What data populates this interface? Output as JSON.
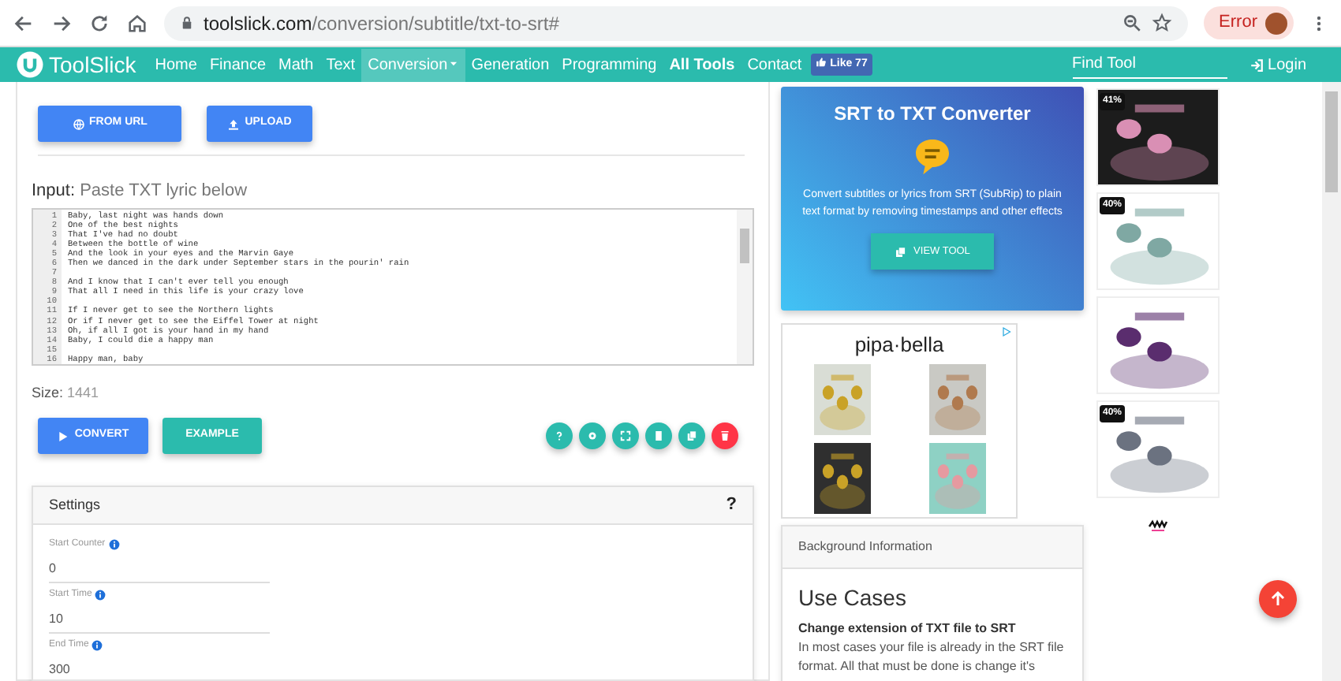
{
  "browser": {
    "url_host": "toolslick.com",
    "url_path": "/conversion/subtitle/txt-to-srt#",
    "profile_status": "Error"
  },
  "navbar": {
    "brand": "ToolSlick",
    "links": [
      {
        "label": "Home",
        "selected": false,
        "bold": false,
        "dropdown": false
      },
      {
        "label": "Finance",
        "selected": false,
        "bold": false,
        "dropdown": false
      },
      {
        "label": "Math",
        "selected": false,
        "bold": false,
        "dropdown": false
      },
      {
        "label": "Text",
        "selected": false,
        "bold": false,
        "dropdown": false
      },
      {
        "label": "Conversion",
        "selected": true,
        "bold": false,
        "dropdown": true
      },
      {
        "label": "Generation",
        "selected": false,
        "bold": false,
        "dropdown": false
      },
      {
        "label": "Programming",
        "selected": false,
        "bold": false,
        "dropdown": false
      },
      {
        "label": "All Tools",
        "selected": false,
        "bold": true,
        "dropdown": false
      },
      {
        "label": "Contact",
        "selected": false,
        "bold": false,
        "dropdown": false
      }
    ],
    "like_badge": "Like 77",
    "search_placeholder": "Find Tool",
    "login": "Login"
  },
  "tool": {
    "source_buttons": [
      "FROM URL",
      "UPLOAD"
    ],
    "input_label": "Input:",
    "input_hint": "Paste TXT lyric below",
    "lines": [
      {
        "number": "1",
        "text": "Baby, last night was hands down"
      },
      {
        "number": "2",
        "text": "One of the best nights"
      },
      {
        "number": "3",
        "text": "That I've had no doubt"
      },
      {
        "number": "4",
        "text": "Between the bottle of wine"
      },
      {
        "number": "5",
        "text": "And the look in your eyes and the Marvin Gaye"
      },
      {
        "number": "6",
        "text": "Then we danced in the dark under September stars in the pourin' rain"
      },
      {
        "number": "7"
      },
      {
        "number": "8",
        "text": "And I know that I can't ever tell you enough"
      },
      {
        "number": "9",
        "text": "That all I need in this life is your crazy love"
      },
      {
        "number": "10"
      },
      {
        "number": "11",
        "text": "If I never get to see the Northern lights"
      },
      {
        "number": "12",
        "text": "Or if I never get to see the Eiffel Tower at night"
      },
      {
        "number": "13",
        "text": "Oh, if all I got is your hand in my hand"
      },
      {
        "number": "14",
        "text": "Baby, I could die a happy man"
      },
      {
        "number": "15"
      },
      {
        "number": "16",
        "text": "Happy man, baby"
      }
    ],
    "size_label": "Size:",
    "size_value": "1441",
    "action_buttons": [
      {
        "label": "CONVERT",
        "kind": "primary"
      },
      {
        "label": "EXAMPLE",
        "kind": "secondary"
      }
    ],
    "round_buttons": [
      {
        "kind": "help",
        "color": "#2bbbad"
      },
      {
        "kind": "settings",
        "color": "#2bbbad"
      },
      {
        "kind": "fullscreen",
        "color": "#2bbbad"
      },
      {
        "kind": "document",
        "color": "#2bbbad"
      },
      {
        "kind": "copy",
        "color": "#2bbbad"
      },
      {
        "kind": "delete",
        "color": "#ff3547"
      }
    ]
  },
  "settings": {
    "title": "Settings",
    "help": "?",
    "fields": [
      {
        "label": "Start Counter",
        "value": "0"
      },
      {
        "label": "Start Time",
        "value": "10"
      },
      {
        "label": "End Time",
        "value": "300"
      }
    ]
  },
  "promo": {
    "title": "SRT to TXT Converter",
    "description": "Convert subtitles or lyrics from SRT (SubRip) to plain text format by removing timestamps and other effects",
    "button": "VIEW TOOL"
  },
  "ad": {
    "brand": "pipa·bella"
  },
  "side_ads": [
    {
      "kind": "discount",
      "badge": "41%"
    },
    {
      "kind": "discount",
      "badge": "40%"
    },
    {
      "kind": "picture"
    },
    {
      "kind": "discount",
      "badge": "40%"
    }
  ],
  "background": {
    "header": "Background Information",
    "heading": "Use Cases",
    "subheading": "Change extension of TXT file to SRT",
    "text": "In most cases your file is already in the SRT file format. All that must be done is change it's"
  }
}
